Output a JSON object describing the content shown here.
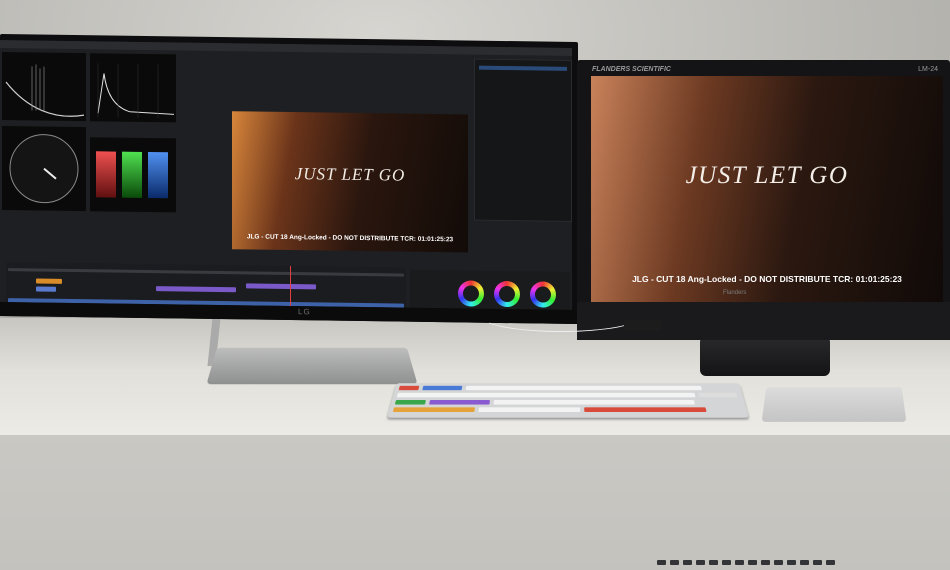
{
  "scene": {
    "left_monitor": {
      "brand": "LG",
      "viewer": {
        "title": "JUST LET GO",
        "timecode_line": "JLG - CUT 18 Ang-Locked - DO NOT DISTRIBUTE  TCR: 01:01:25:23"
      }
    },
    "right_monitor": {
      "brand": "FLANDERS SCIENTIFIC",
      "model": "LM-24",
      "bezel_label": "Flanders",
      "viewer": {
        "title": "JUST LET GO",
        "timecode_line": "JLG - CUT 18 Ang-Locked - DO NOT DISTRIBUTE  TCR: 01:01:25:23"
      }
    },
    "colors": {
      "wall": "#c4c3be",
      "desk": "#e6e4de",
      "monitor_bezel": "#0d0d0f",
      "footage_warm": "#d8863b",
      "footage_dark": "#120b08"
    }
  }
}
